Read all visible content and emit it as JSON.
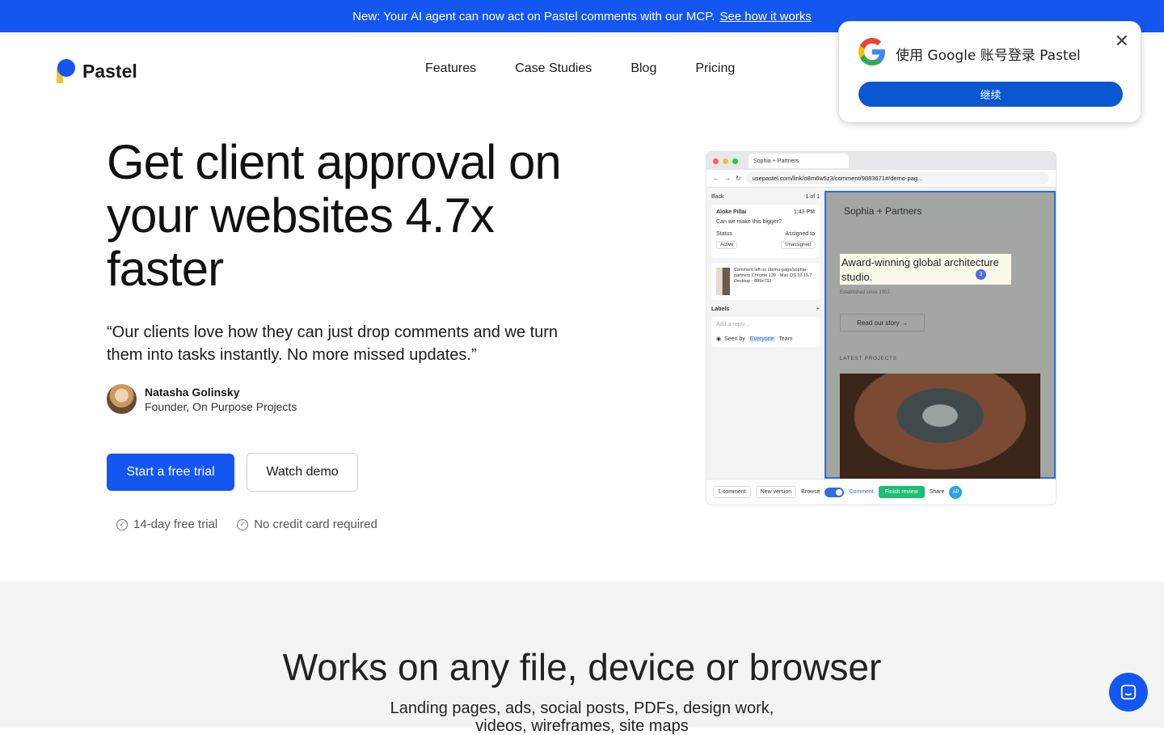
{
  "banner": {
    "text": "New: Your AI agent can now act on Pastel comments with our MCP.",
    "link": "See how it works"
  },
  "brand": {
    "name": "Pastel"
  },
  "nav": {
    "items": [
      "Features",
      "Case Studies",
      "Blog",
      "Pricing"
    ]
  },
  "hero": {
    "title": "Get client approval on your websites 4.7x faster",
    "quote": "“Our clients love how they can just drop comments and we turn them into tasks instantly. No more missed updates.”",
    "author_name": "Natasha Golinsky",
    "author_role": "Founder, On Purpose Projects",
    "primary_cta": "Start a free trial",
    "secondary_cta": "Watch demo",
    "perks": [
      "14-day free trial",
      "No credit card required"
    ]
  },
  "mockup": {
    "tab_title": "Sophia + Partners",
    "url": "usepastel.com/link/o8m6w5z3/comment/9883671#/demo-pag...",
    "back": "Back",
    "pager": "1 of 1",
    "commenter": "Aloke Pillai",
    "comment_time": "1:43 PM",
    "comment_text": "Can we make this bigger?",
    "status_label": "Status",
    "assigned_label": "Assigned to",
    "status_value": "Active",
    "assigned_value": "Unassigned",
    "comment_meta": "Comment left on /demo-page/sophia-partners Chrome 139 · Mac OS 10.15.7 Desktop · 889x732",
    "labels_label": "Labels",
    "reply_placeholder": "Add a reply...",
    "seen_by": "Seen by",
    "everyone": "Everyone",
    "team": "Team",
    "page_title": "Sophia + Partners",
    "page_headline": "Award-winning global architecture studio.",
    "pin_number": "3",
    "page_sub": "Established since 1952.",
    "page_button": "Read our story →",
    "page_section": "LATEST PROJECTS",
    "bar_comment": "1 comment",
    "bar_version": "New version",
    "bar_browse": "Browse",
    "bar_comment_mode": "Comment",
    "bar_finish": "Finish review",
    "bar_share": "Share",
    "bar_avatar": "AP"
  },
  "google_popup": {
    "title": "使用 Google 账号登录 Pastel",
    "button": "继续"
  },
  "section2": {
    "title": "Works on any file, device or browser",
    "subtitle_line1": "Landing pages, ads, social posts, PDFs, design work,",
    "subtitle_line2": "videos, wireframes, site maps"
  },
  "colors": {
    "primary": "#1456f0",
    "google_button": "#0b57d0",
    "finish_green": "#1bbf73"
  }
}
